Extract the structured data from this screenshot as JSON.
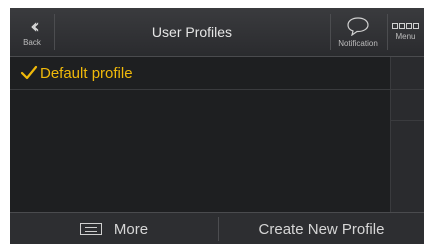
{
  "header": {
    "back_label": "Back",
    "title": "User Profiles",
    "notification_label": "Notification",
    "menu_label": "Menu"
  },
  "profiles": [
    {
      "label": "Default profile",
      "selected": true
    }
  ],
  "footer": {
    "more_label": "More",
    "create_label": "Create New Profile"
  },
  "colors": {
    "accent": "#f0b90a",
    "background": "#1e1f21",
    "header": "#2f3033"
  },
  "icons": {
    "back": "double-chevron-left-icon",
    "notification": "speech-bubble-icon",
    "menu": "menu-grid-icon",
    "check": "checkmark-icon",
    "more": "list-icon"
  }
}
